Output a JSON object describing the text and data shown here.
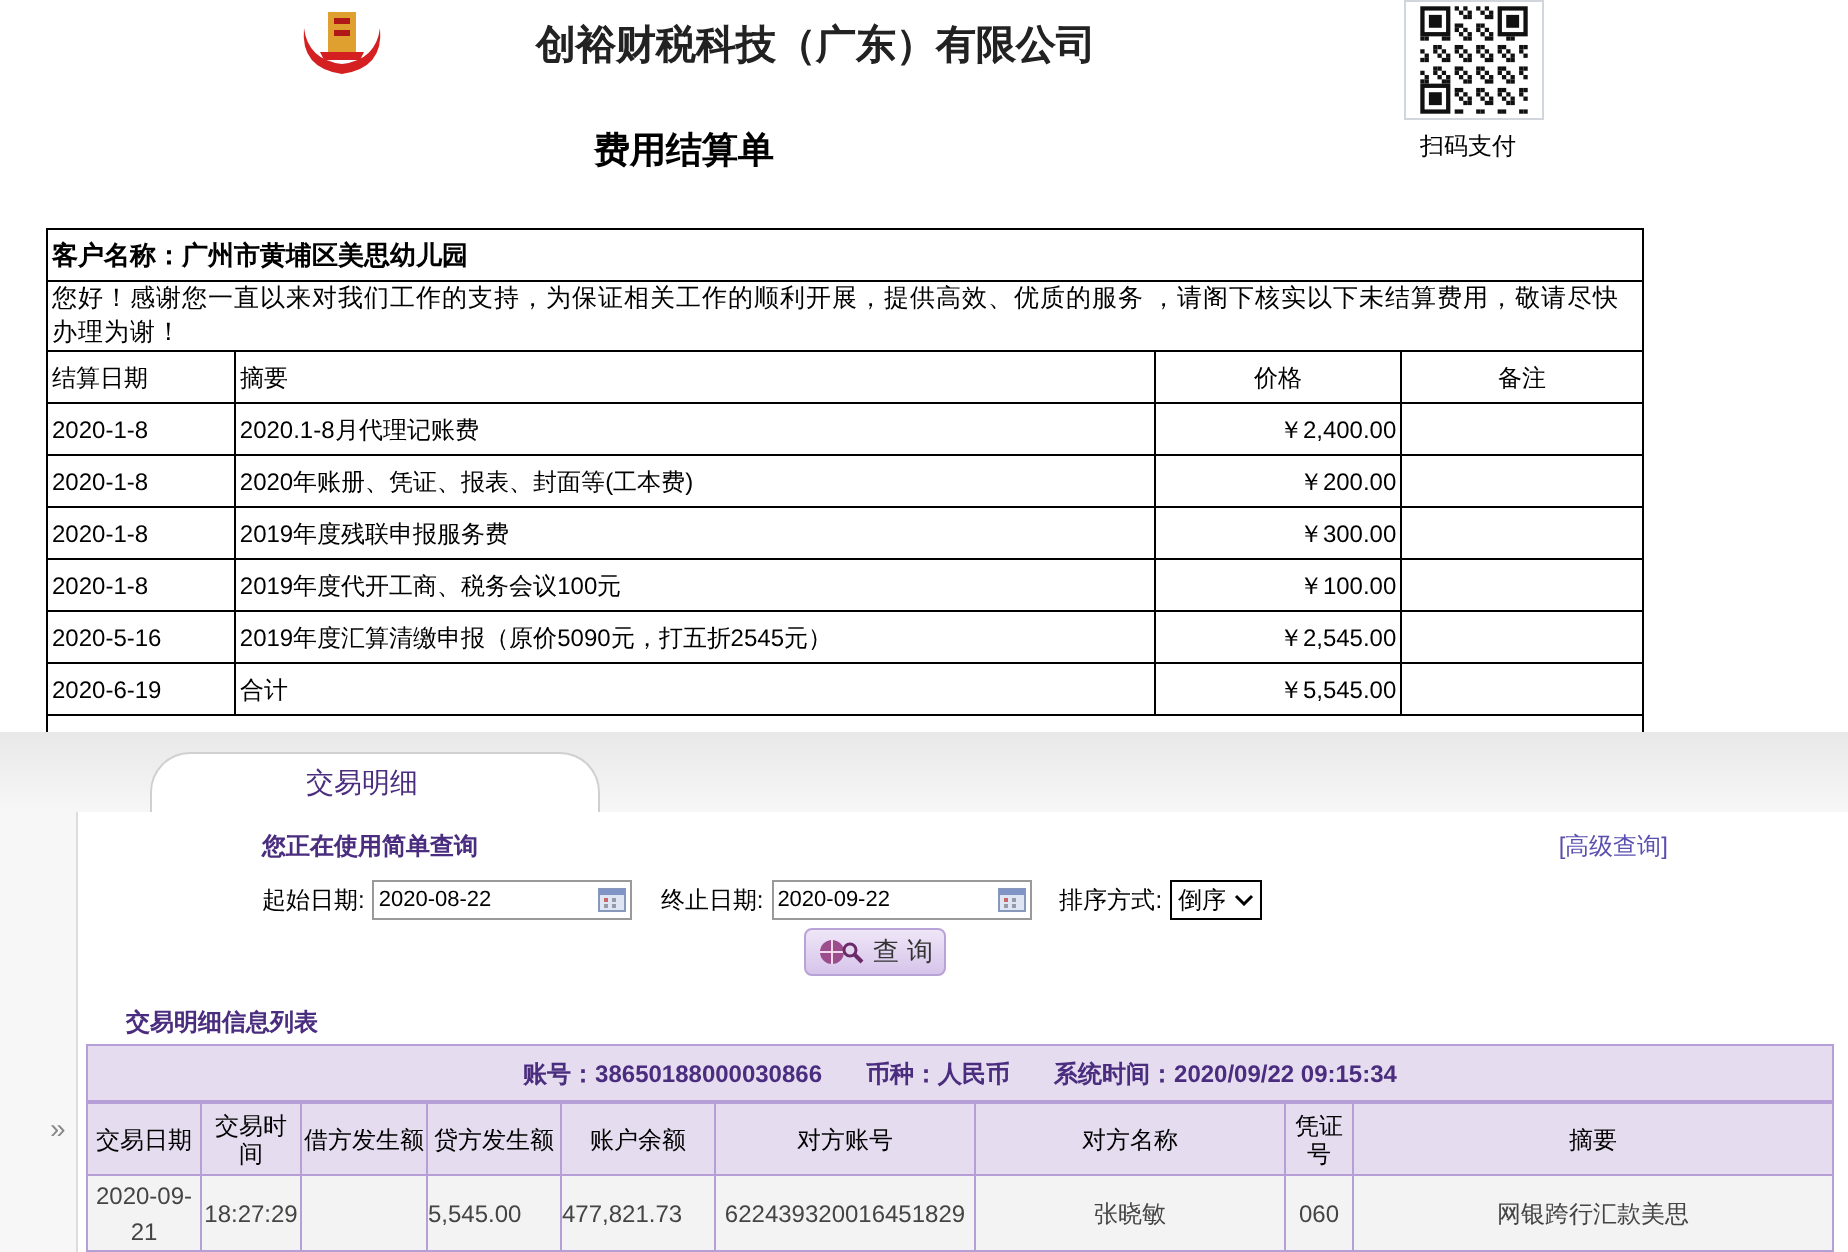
{
  "invoice": {
    "company": "创裕财税科技（广东）有限公司",
    "title": "费用结算单",
    "qr_caption": "扫码支付",
    "customer": "客户名称：广州市黄埔区美思幼儿园",
    "greeting": "您好！感谢您一直以来对我们工作的支持，为保证相关工作的顺利开展，提供高效、优质的服务 ，请阁下核实以下未结算费用，敬请尽快办理为谢！",
    "columns": [
      "结算日期",
      "摘要",
      "价格",
      "备注"
    ],
    "rows": [
      {
        "date": "2020-1-8",
        "summary": "2020.1-8月代理记账费",
        "price": "￥2,400.00"
      },
      {
        "date": "2020-1-8",
        "summary": "2020年账册、凭证、报表、封面等(工本费)",
        "price": "￥200.00"
      },
      {
        "date": "2020-1-8",
        "summary": "2019年度残联申报服务费",
        "price": "￥300.00"
      },
      {
        "date": "2020-1-8",
        "summary": "2019年度代开工商、税务会议100元",
        "price": "￥100.00"
      },
      {
        "date": "2020-5-16",
        "summary": "2019年度汇算清缴申报（原价5090元，打五折2545元）",
        "price": "￥2,545.00"
      },
      {
        "date": "2020-6-19",
        "summary": "合计",
        "price": "￥5,545.00"
      }
    ]
  },
  "bank": {
    "tab": "交易明细",
    "query_title": "您正在使用简单查询",
    "advanced_link": "[高级查询]",
    "start_label": "起始日期:",
    "start_value": "2020-08-22",
    "end_label": "终止日期:",
    "end_value": "2020-09-22",
    "sort_label": "排序方式:",
    "sort_value": "倒序",
    "query_button": "查 询",
    "list_title": "交易明细信息列表",
    "account": "账号：38650188000030866",
    "currency": "币种：人民币",
    "system_time": "系统时间：2020/09/22 09:15:34",
    "expand": "»",
    "columns": [
      "交易日期",
      "交易时间",
      "借方发生额",
      "贷方发生额",
      "账户余额",
      "对方账号",
      "对方名称",
      "凭证号",
      "摘要"
    ],
    "rows": [
      [
        "2020-09-21",
        "18:27:29",
        "",
        "5,545.00",
        "477,821.73",
        "622439320016451829",
        "张晓敏",
        "060",
        "网银跨行汇款美思"
      ]
    ]
  }
}
